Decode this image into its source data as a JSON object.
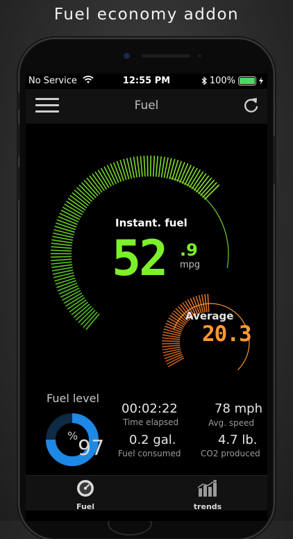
{
  "headline": "Fuel economy addon",
  "status_bar": {
    "carrier": "No Service",
    "time": "12:55 PM",
    "battery": "100%"
  },
  "nav": {
    "title": "Fuel",
    "menu_icon": "hamburger-menu-icon",
    "refresh_icon": "refresh-icon"
  },
  "instant": {
    "label": "Instant. fuel",
    "value_int": "52",
    "value_dec": ".9",
    "unit": "mpg",
    "gauge_fraction": 0.62
  },
  "average": {
    "label": "Average",
    "value": "20.3"
  },
  "fuel_level": {
    "label": "Fuel level",
    "unit": "%",
    "value": "97",
    "fraction": 0.75
  },
  "stats": [
    {
      "value": "00:02:22",
      "label": "Time elapsed"
    },
    {
      "value": "78 mph",
      "label": "Avg. speed"
    },
    {
      "value": "0.2 gal.",
      "label": "Fuel consumed"
    },
    {
      "value": "4.7 lb.",
      "label": "CO2 produced"
    }
  ],
  "tabs": [
    {
      "label": "Fuel",
      "icon": "fuel-gauge-icon"
    },
    {
      "label": "trends",
      "icon": "bar-chart-icon"
    }
  ],
  "colors": {
    "instant": "#7cf12b",
    "average": "#ff9933",
    "fuel_level": "#1e88e5"
  }
}
